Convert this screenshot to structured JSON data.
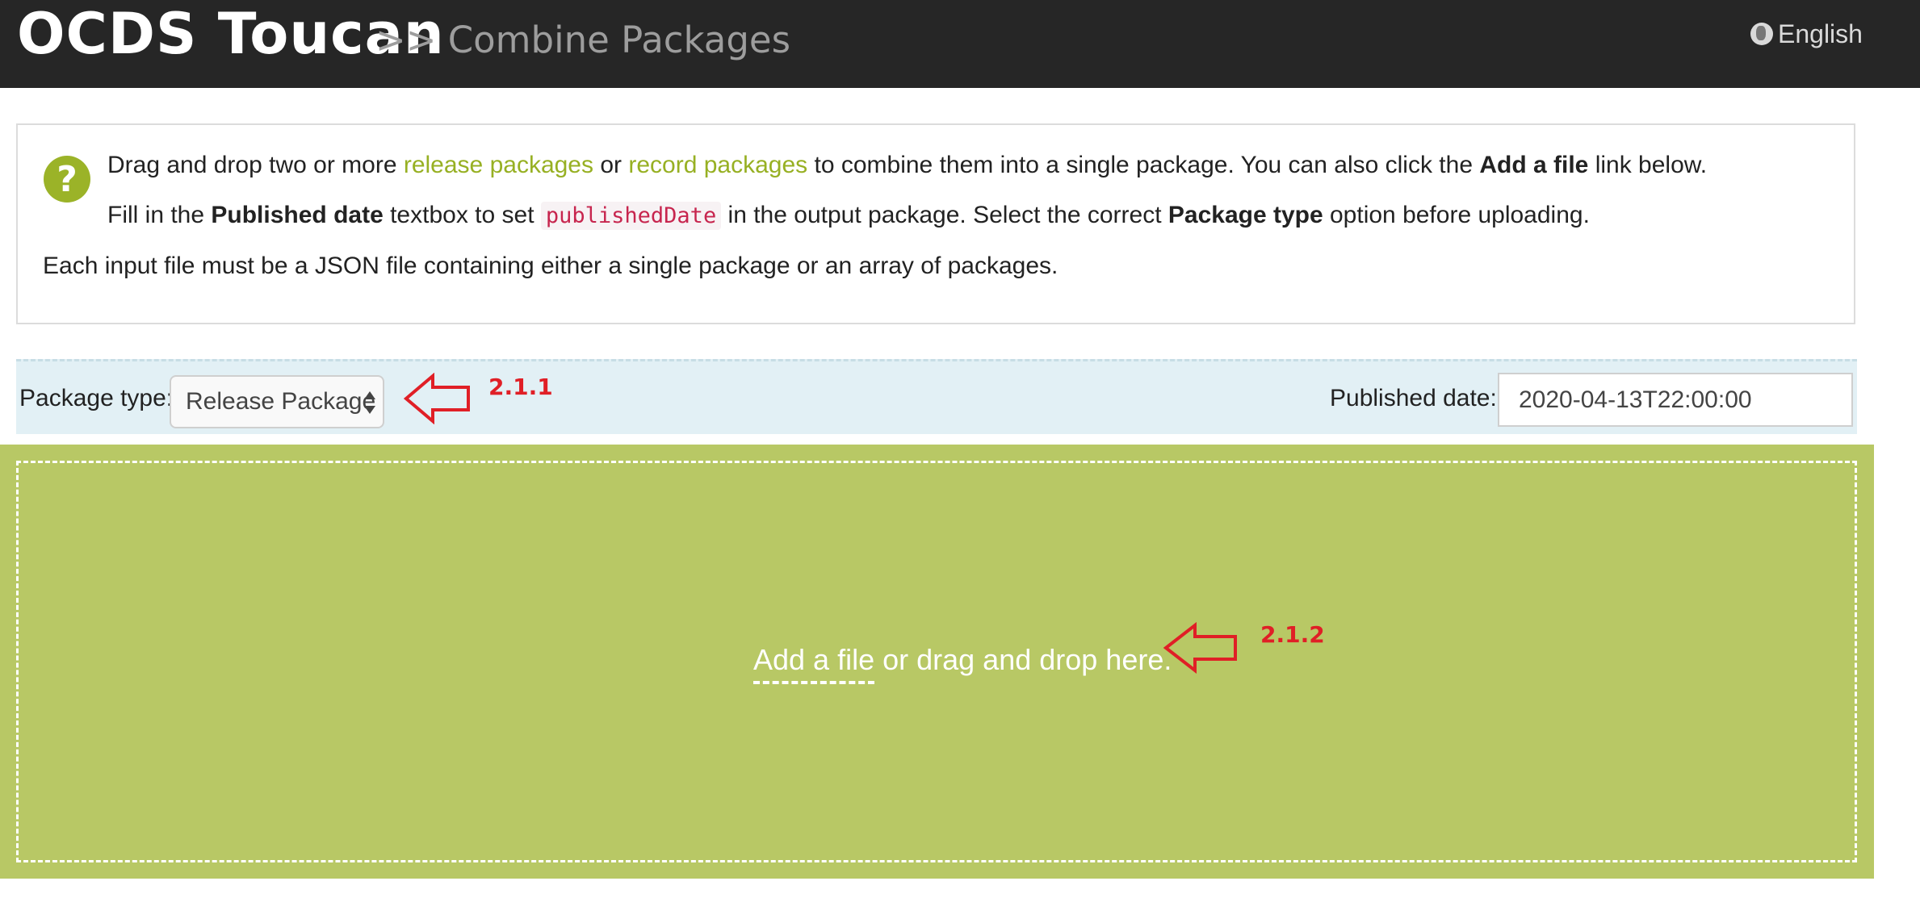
{
  "header": {
    "brand": "OCDS Toucan",
    "breadcrumb": ">> Combine Packages",
    "language": "English"
  },
  "info": {
    "line1": {
      "prefix": "Drag and drop two or more ",
      "link1": "release packages",
      "mid": " or ",
      "link2": "record packages",
      "suffix": " to combine them into a single package. You can also click the ",
      "bold": "Add a file",
      "end": " link below."
    },
    "line2": {
      "prefix": "Fill in the ",
      "bold1": "Published date",
      "mid1": " textbox to set ",
      "code": "publishedDate",
      "mid2": " in the output package. Select the correct ",
      "bold2": "Package type",
      "end": " option before uploading."
    },
    "line3": "Each input file must be a JSON file containing either a single package or an array of packages."
  },
  "options": {
    "package_type_label": "Package type:",
    "package_type_value": "Release Package",
    "published_date_label": "Published date:",
    "published_date_value": "2020-04-13T22:00:00"
  },
  "dropzone": {
    "add_link": "Add a file",
    "text": " or drag and drop here."
  },
  "annotations": {
    "a1": "2.1.1",
    "a2": "2.1.2",
    "color": "#e01f26"
  },
  "colors": {
    "topbar": "#262626",
    "accent_green": "#97b023",
    "dropzone": "#b8c865",
    "options_bg": "#e2f0f5"
  }
}
